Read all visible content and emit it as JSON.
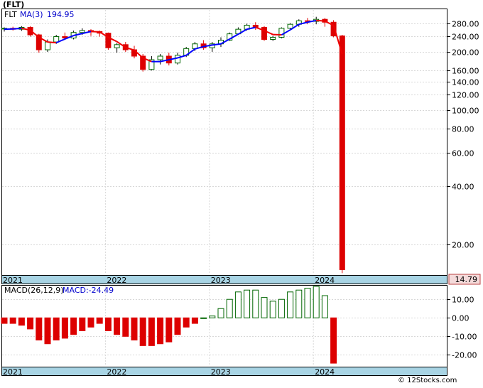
{
  "chart_data": [
    {
      "type": "candlestick",
      "title": "(FLT)",
      "legend": {
        "symbol": "FLT",
        "ma_label": "MA(3)",
        "ma_value": "194.95"
      },
      "scale": "log",
      "ylim": [
        14,
        330
      ],
      "y_ticks": [
        "280.00",
        "240.00",
        "200.00",
        "160.00",
        "140.00",
        "120.00",
        "100.00",
        "80.00",
        "60.00",
        "40.00",
        "20.00"
      ],
      "y_tick_values": [
        280,
        240,
        200,
        160,
        140,
        120,
        100,
        80,
        60,
        40,
        20
      ],
      "x_labels": [
        "2021",
        "2022",
        "2023",
        "2024"
      ],
      "x_label_index": [
        0,
        12,
        24,
        36
      ],
      "last_price": "14.79",
      "ohlc": [
        [
          263,
          268,
          255,
          265
        ],
        [
          265,
          270,
          258,
          262
        ],
        [
          262,
          272,
          257,
          268
        ],
        [
          268,
          272,
          240,
          245
        ],
        [
          245,
          248,
          198,
          205
        ],
        [
          205,
          232,
          200,
          225
        ],
        [
          225,
          245,
          220,
          240
        ],
        [
          240,
          252,
          232,
          236
        ],
        [
          236,
          258,
          232,
          252
        ],
        [
          252,
          265,
          245,
          258
        ],
        [
          258,
          262,
          242,
          255
        ],
        [
          255,
          258,
          240,
          250
        ],
        [
          250,
          252,
          205,
          210
        ],
        [
          210,
          222,
          198,
          218
        ],
        [
          218,
          225,
          200,
          205
        ],
        [
          205,
          215,
          185,
          190
        ],
        [
          190,
          195,
          158,
          162
        ],
        [
          162,
          190,
          160,
          182
        ],
        [
          182,
          195,
          172,
          190
        ],
        [
          190,
          198,
          170,
          175
        ],
        [
          175,
          198,
          172,
          192
        ],
        [
          192,
          212,
          188,
          208
        ],
        [
          208,
          225,
          202,
          220
        ],
        [
          220,
          230,
          205,
          210
        ],
        [
          210,
          225,
          200,
          220
        ],
        [
          220,
          238,
          212,
          230
        ],
        [
          230,
          252,
          228,
          248
        ],
        [
          248,
          268,
          245,
          262
        ],
        [
          262,
          280,
          258,
          275
        ],
        [
          275,
          285,
          260,
          268
        ],
        [
          268,
          272,
          228,
          232
        ],
        [
          232,
          242,
          228,
          238
        ],
        [
          238,
          268,
          235,
          265
        ],
        [
          265,
          282,
          262,
          278
        ],
        [
          278,
          295,
          270,
          290
        ],
        [
          290,
          300,
          278,
          288
        ],
        [
          288,
          304,
          278,
          295
        ],
        [
          295,
          300,
          270,
          285
        ],
        [
          285,
          292,
          238,
          242
        ],
        [
          242,
          245,
          14.2,
          14.79
        ]
      ],
      "ma": [
        262,
        263,
        265,
        259,
        238,
        225,
        223,
        233,
        243,
        249,
        255,
        254,
        238,
        226,
        211,
        204,
        186,
        178,
        178,
        182,
        186,
        192,
        207,
        213,
        217,
        220,
        233,
        247,
        262,
        268,
        258,
        246,
        245,
        260,
        278,
        285,
        291,
        289,
        274,
        195
      ]
    },
    {
      "type": "bar",
      "title": "MACD(26,12,9)",
      "legend": {
        "label": "MACD(26,12,9)",
        "value_label": "MACD:-24.49"
      },
      "ylim": [
        -26,
        17
      ],
      "y_ticks": [
        "10.00",
        "0.00",
        "-10.00",
        "-20.00"
      ],
      "y_tick_values": [
        10,
        0,
        -10,
        -20
      ],
      "x_labels": [
        "2021",
        "2022",
        "2023",
        "2024"
      ],
      "x_label_index": [
        0,
        12,
        24,
        36
      ],
      "values": [
        -3,
        -3,
        -4,
        -6,
        -12,
        -14,
        -12,
        -11,
        -9,
        -7,
        -5,
        -3,
        -7,
        -9,
        -10,
        -12,
        -15,
        -15,
        -14,
        -13,
        -9,
        -5,
        -3,
        0,
        1,
        5,
        10,
        14,
        15,
        15,
        11,
        9,
        10,
        14,
        15,
        16,
        17,
        12,
        -24.49
      ]
    }
  ],
  "footer": {
    "copyright": "© 12Stocks.com"
  }
}
